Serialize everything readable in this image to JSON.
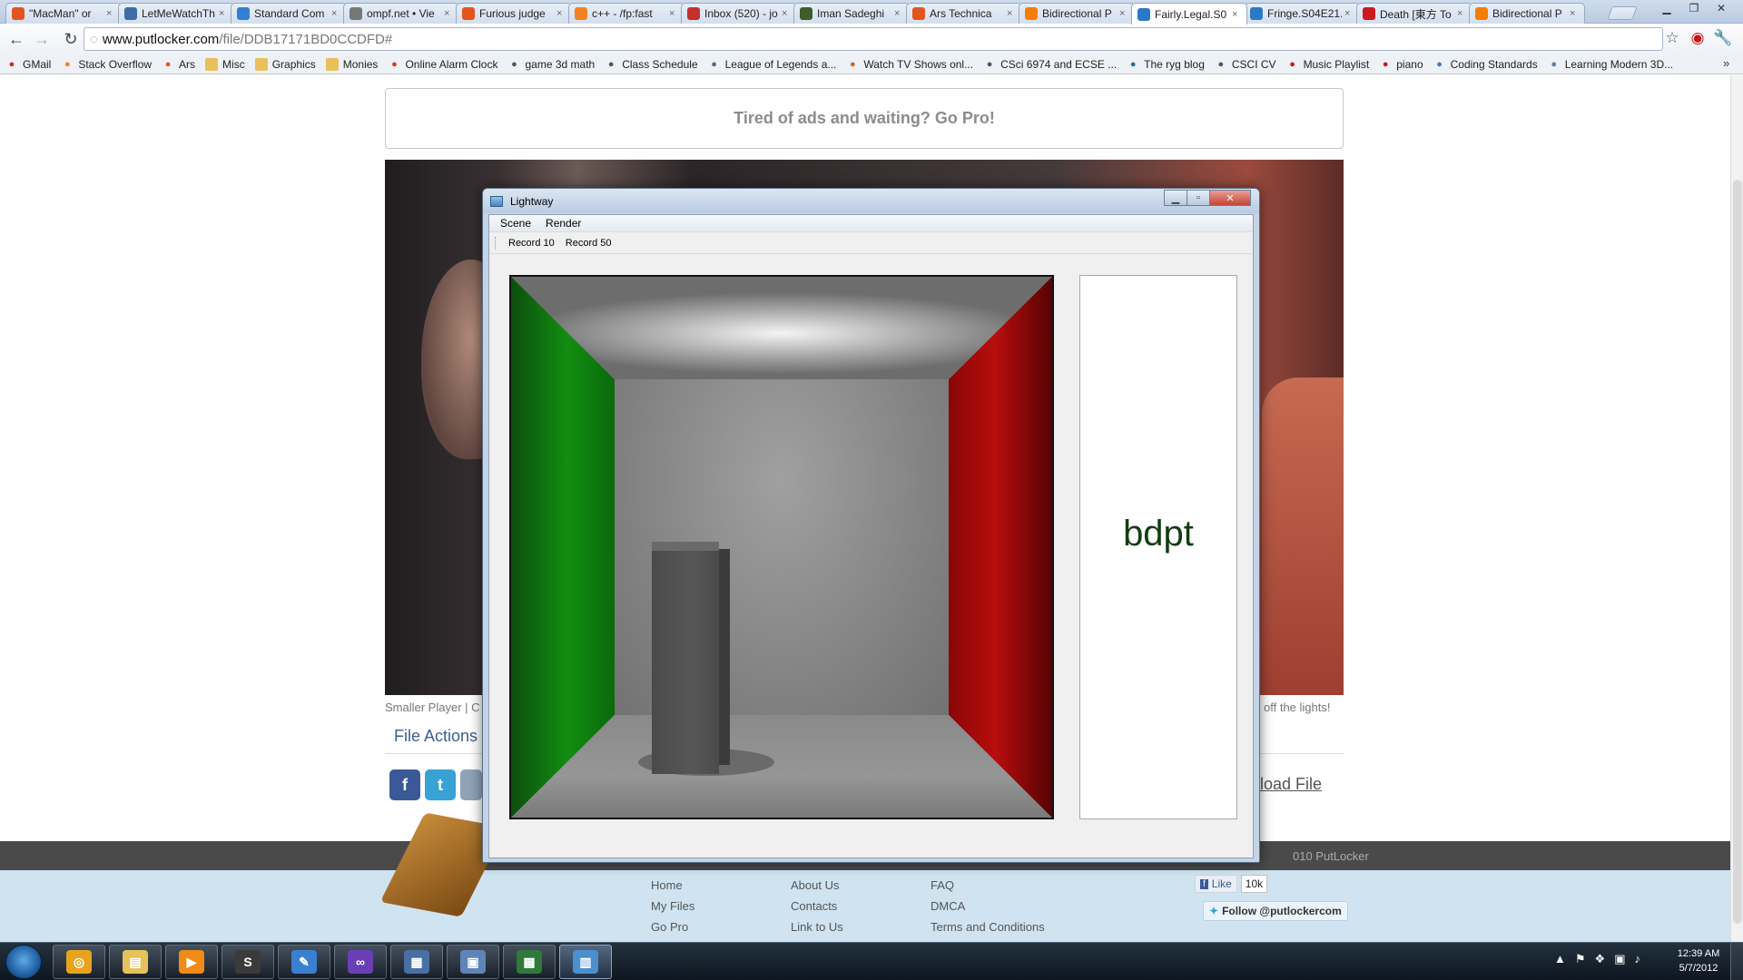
{
  "browser": {
    "tabs": [
      {
        "label": "\"MacMan\" or",
        "icon": "ars-icon",
        "color": "#e3551d"
      },
      {
        "label": "LetMeWatchTh",
        "icon": "page-icon",
        "color": "#3b6ea5"
      },
      {
        "label": "Standard Com",
        "icon": "globe-icon",
        "color": "#2f7fd4"
      },
      {
        "label": "ompf.net • Vie",
        "icon": "globe-icon",
        "color": "#777777"
      },
      {
        "label": "Furious judge",
        "icon": "ars-icon",
        "color": "#e3551d"
      },
      {
        "label": "c++ - /fp:fast",
        "icon": "stackoverflow-icon",
        "color": "#f48024"
      },
      {
        "label": "Inbox (520) - jo",
        "icon": "gmail-icon",
        "color": "#c4302b"
      },
      {
        "label": "Iman Sadeghi",
        "icon": "photo-icon",
        "color": "#3d5e2a"
      },
      {
        "label": "Ars Technica",
        "icon": "ars-icon",
        "color": "#e3551d"
      },
      {
        "label": "Bidirectional P",
        "icon": "blogger-icon",
        "color": "#f57d00"
      },
      {
        "label": "Fairly.Legal.S0",
        "icon": "putlocker-icon",
        "color": "#2a79c9",
        "active": true
      },
      {
        "label": "Fringe.S04E21.",
        "icon": "putlocker-icon",
        "color": "#2a79c9"
      },
      {
        "label": "Death [東方 To",
        "icon": "youtube-icon",
        "color": "#cc181e"
      },
      {
        "label": "Bidirectional P",
        "icon": "blogger-icon",
        "color": "#f57d00"
      }
    ],
    "close_glyph": "×",
    "url": {
      "host": "www.putlocker.com",
      "path": "/file/DDB17171BD0CCDFD#"
    },
    "bookmarks": [
      {
        "label": "GMail",
        "icon": "gmail-icon",
        "color": "#c4302b"
      },
      {
        "label": "Stack Overflow",
        "icon": "stackoverflow-icon",
        "color": "#f48024"
      },
      {
        "label": "Ars",
        "icon": "ars-icon",
        "color": "#e3551d"
      },
      {
        "label": "Misc",
        "icon": "folder-icon",
        "color": "#e8c15a"
      },
      {
        "label": "Graphics",
        "icon": "folder-icon",
        "color": "#e8c15a"
      },
      {
        "label": "Monies",
        "icon": "folder-icon",
        "color": "#e8c15a"
      },
      {
        "label": "Online Alarm Clock",
        "icon": "k-icon",
        "color": "#d9381e"
      },
      {
        "label": "game 3d math",
        "icon": "globe-icon",
        "color": "#555555"
      },
      {
        "label": "Class Schedule",
        "icon": "globe-icon",
        "color": "#555555"
      },
      {
        "label": "League of Legends a...",
        "icon": "game-icon",
        "color": "#666666"
      },
      {
        "label": "Watch TV Shows onl...",
        "icon": "tv-icon",
        "color": "#d26a1c"
      },
      {
        "label": "CSci 6974 and ECSE ...",
        "icon": "globe-icon",
        "color": "#555555"
      },
      {
        "label": "The ryg blog",
        "icon": "wordpress-icon",
        "color": "#21759b"
      },
      {
        "label": "CSCI CV",
        "icon": "globe-icon",
        "color": "#555555"
      },
      {
        "label": "Music Playlist",
        "icon": "youtube-icon",
        "color": "#cc181e"
      },
      {
        "label": "piano",
        "icon": "youtube-icon",
        "color": "#cc181e"
      },
      {
        "label": "Coding Standards",
        "icon": "globe-icon",
        "color": "#3a7ac2"
      },
      {
        "label": "Learning Modern 3D...",
        "icon": "page-icon",
        "color": "#5a7ab0"
      }
    ],
    "more_glyph": "»"
  },
  "page": {
    "promo": "Tired of ads and waiting? Go Pro!",
    "player_links": "Smaller Player | C",
    "lights": "off the lights!",
    "file_actions": "File Actions",
    "download": "load File",
    "copyright": "010 PutLocker",
    "footer_cols": [
      [
        "Home",
        "My Files",
        "Go Pro"
      ],
      [
        "About Us",
        "Contacts",
        "Link to Us"
      ],
      [
        "FAQ",
        "DMCA",
        "Terms and Conditions"
      ]
    ],
    "fb_like": "Like",
    "fb_count": "10k",
    "follow": "Follow @putlockercom"
  },
  "lightway": {
    "title": "Lightway",
    "menu": [
      "Scene",
      "Render"
    ],
    "toolbar": [
      "Record 10",
      "Record 50"
    ],
    "mode_label": "bdpt"
  },
  "taskbar": {
    "apps": [
      {
        "name": "chrome",
        "glyph": "◎",
        "color": "#e8a31c"
      },
      {
        "name": "explorer",
        "glyph": "▤",
        "color": "#e5c25a"
      },
      {
        "name": "media-player",
        "glyph": "▶",
        "color": "#f08a18"
      },
      {
        "name": "sublime",
        "glyph": "S",
        "color": "#3b3b3b"
      },
      {
        "name": "notepad",
        "glyph": "✎",
        "color": "#3b7fd0"
      },
      {
        "name": "visual-studio",
        "glyph": "∞",
        "color": "#6a3fb5"
      },
      {
        "name": "app-7",
        "glyph": "▦",
        "color": "#4a6fa5"
      },
      {
        "name": "app-8",
        "glyph": "▣",
        "color": "#5f84b8"
      },
      {
        "name": "app-9",
        "glyph": "▩",
        "color": "#2f7a3a"
      },
      {
        "name": "lightway",
        "glyph": "▥",
        "color": "#4b8fcf"
      }
    ],
    "time": "12:39 AM",
    "date": "5/7/2012"
  }
}
